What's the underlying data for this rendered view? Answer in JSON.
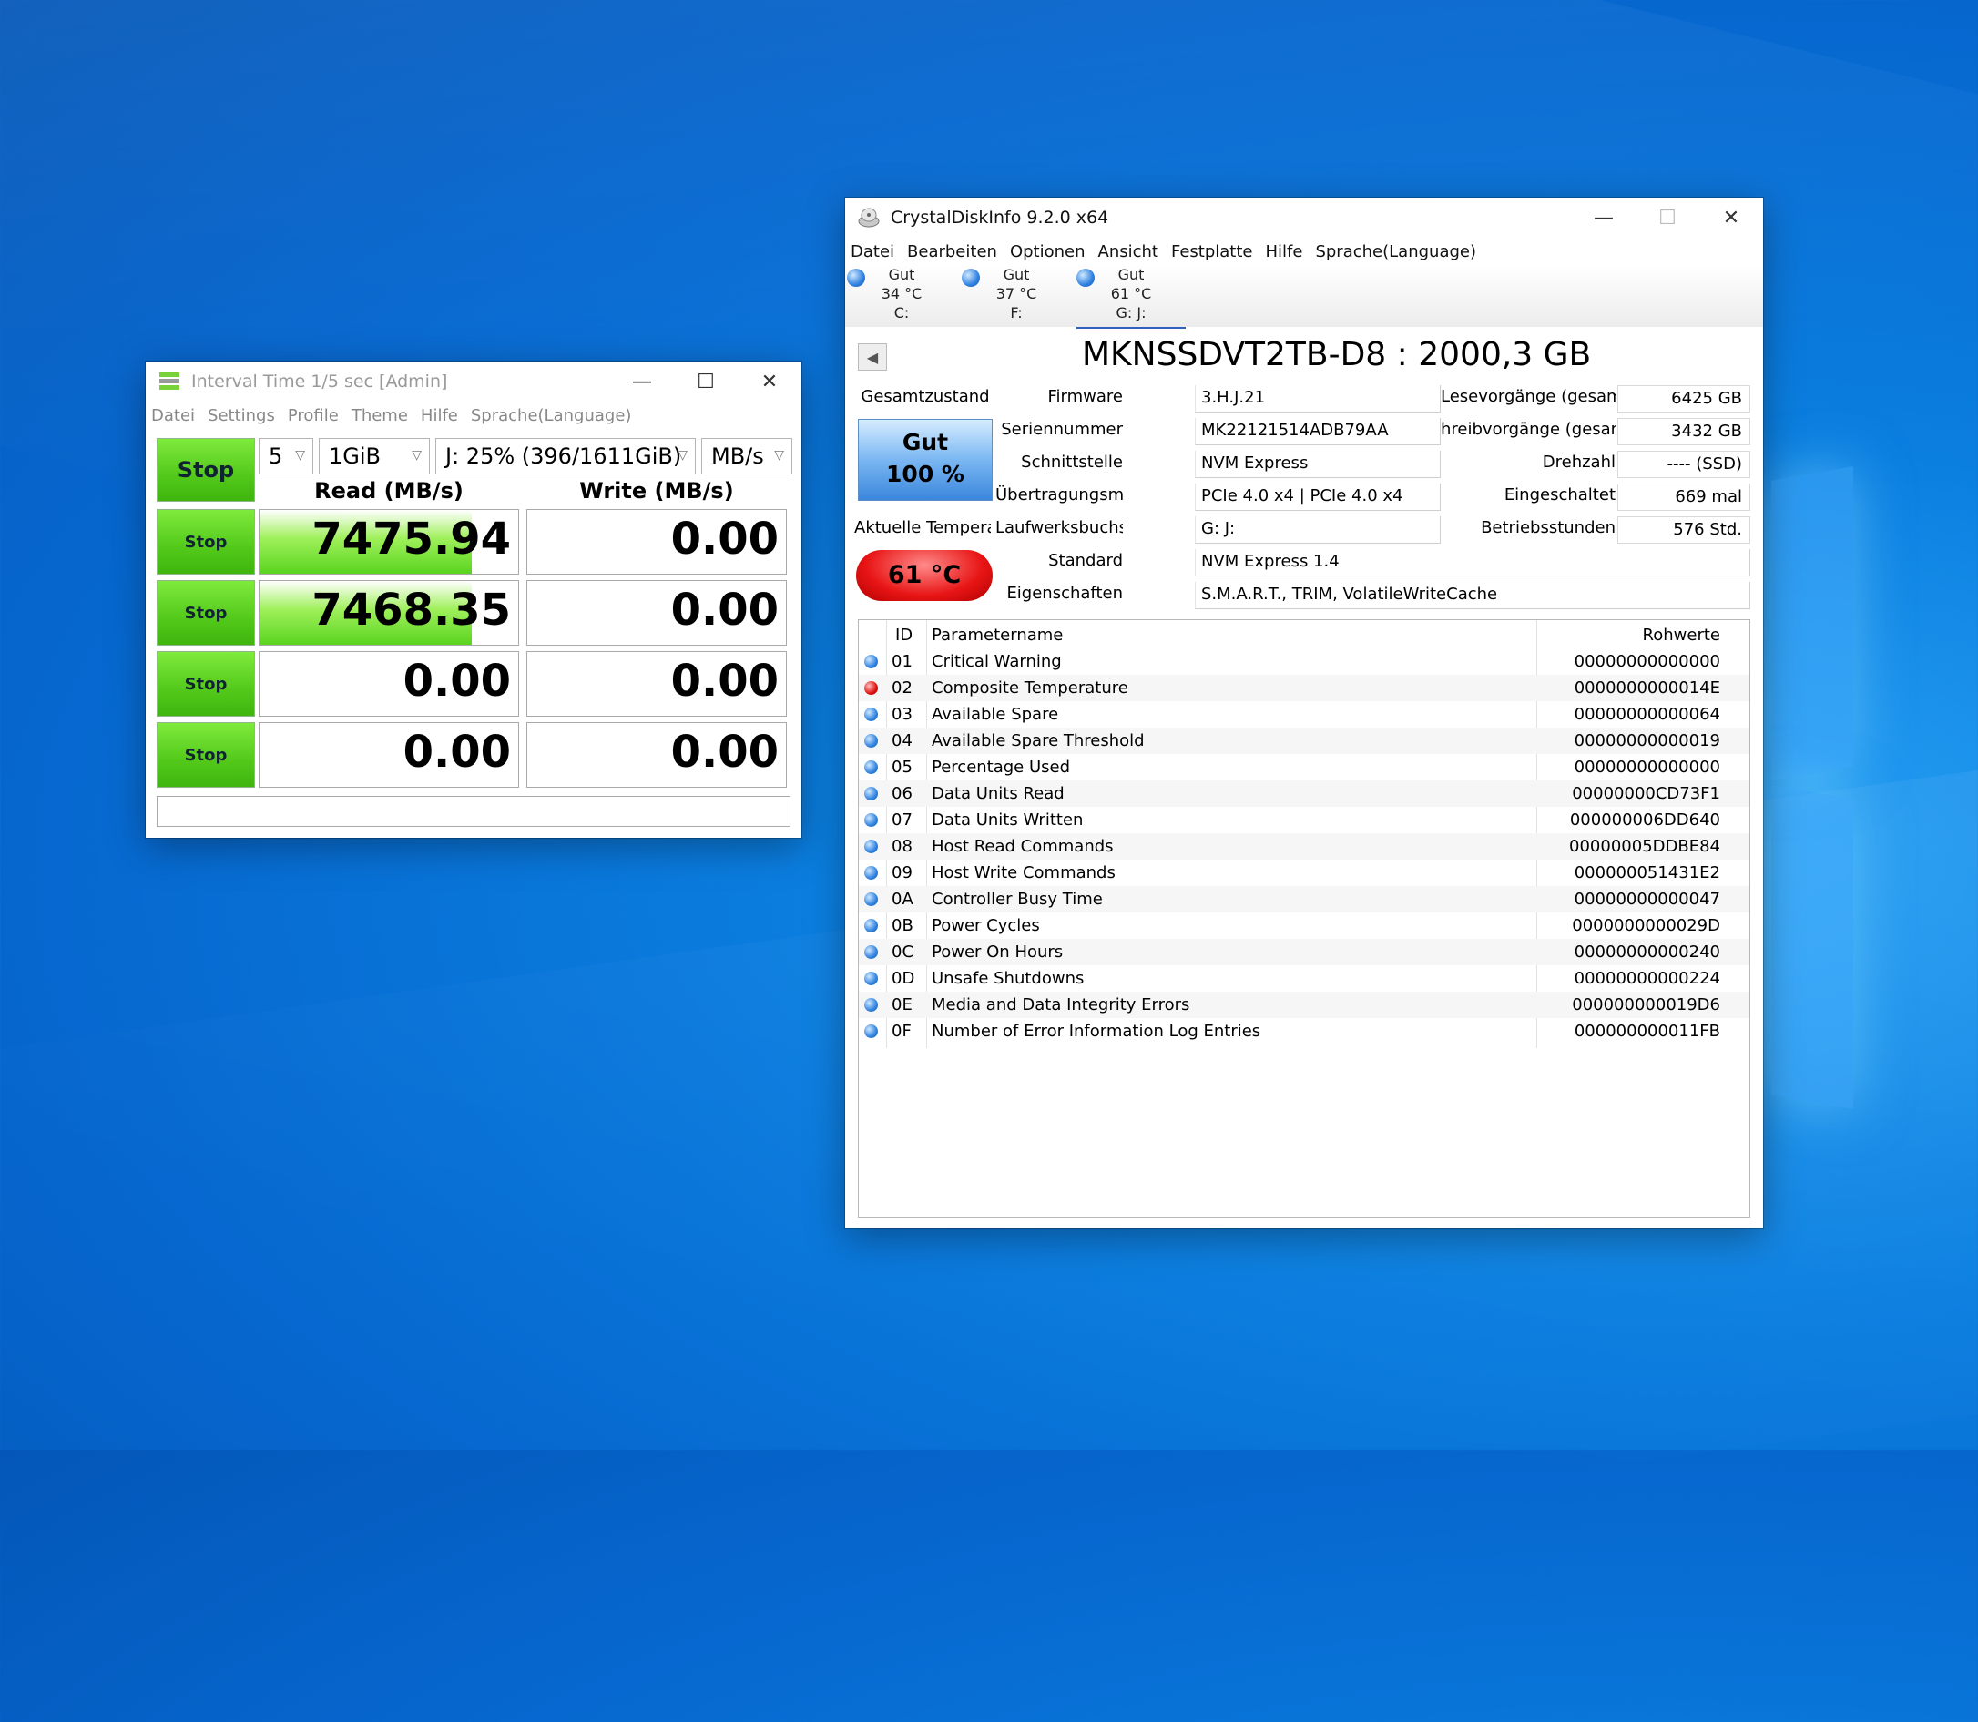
{
  "diskmark": {
    "title": "Interval Time 1/5 sec [Admin]",
    "menu": [
      "Datei",
      "Settings",
      "Profile",
      "Theme",
      "Hilfe",
      "Sprache(Language)"
    ],
    "stop_all_label": "Stop",
    "count": "5",
    "size": "1GiB",
    "drive": "J: 25% (396/1611GiB)",
    "unit": "MB/s",
    "read_header": "Read (MB/s)",
    "write_header": "Write (MB/s)",
    "rows": [
      {
        "stop": "Stop",
        "read": "7475.94",
        "write": "0.00",
        "read_fill": 0.82
      },
      {
        "stop": "Stop",
        "read": "7468.35",
        "write": "0.00",
        "read_fill": 0.82
      },
      {
        "stop": "Stop",
        "read": "0.00",
        "write": "0.00",
        "read_fill": 0
      },
      {
        "stop": "Stop",
        "read": "0.00",
        "write": "0.00",
        "read_fill": 0
      }
    ],
    "status": ""
  },
  "cdi": {
    "title": "CrystalDiskInfo 9.2.0 x64",
    "menu": [
      "Datei",
      "Bearbeiten",
      "Optionen",
      "Ansicht",
      "Festplatte",
      "Hilfe",
      "Sprache(Language)"
    ],
    "drives": [
      {
        "status": "Gut",
        "temp": "34 °C",
        "letter": "C:"
      },
      {
        "status": "Gut",
        "temp": "37 °C",
        "letter": "F:"
      },
      {
        "status": "Gut",
        "temp": "61 °C",
        "letter": "G: J:"
      }
    ],
    "model": "MKNSSDVT2TB-D8 : 2000,3 GB",
    "health_label": "Gesamtzustand",
    "health_status": "Gut",
    "health_percent": "100 %",
    "temp_label": "Aktuelle Temperatu",
    "temp_value": "61 °C",
    "info": {
      "firmware_label": "Firmware",
      "firmware": "3.H.J.21",
      "serial_label": "Seriennummer",
      "serial": "MK22121514ADB79AA",
      "interface_label": "Schnittstelle",
      "interface": "NVM Express",
      "transfer_label": "Übertragungsmodus",
      "transfer": "PCIe 4.0 x4 | PCIe 4.0 x4",
      "letters_label": "Laufwerksbuchstaben",
      "letters": "G: J:",
      "standard_label": "Standard",
      "standard": "NVM Express 1.4",
      "features_label": "Eigenschaften",
      "features": "S.M.A.R.T., TRIM, VolatileWriteCache",
      "reads_label": "Lesevorgänge (gesamt)",
      "reads": "6425 GB",
      "writes_label": "hreibvorgänge (gesamt)",
      "writes": "3432 GB",
      "rpm_label": "Drehzahl",
      "rpm": "---- (SSD)",
      "poweron_label": "Eingeschaltet",
      "poweron": "669 mal",
      "hours_label": "Betriebsstunden",
      "hours": "576 Std."
    },
    "smart_headers": {
      "id": "ID",
      "name": "Parametername",
      "raw": "Rohwerte"
    },
    "smart": [
      {
        "id": "01",
        "name": "Critical Warning",
        "raw": "00000000000000",
        "alert": false
      },
      {
        "id": "02",
        "name": "Composite Temperature",
        "raw": "0000000000014E",
        "alert": true
      },
      {
        "id": "03",
        "name": "Available Spare",
        "raw": "00000000000064",
        "alert": false
      },
      {
        "id": "04",
        "name": "Available Spare Threshold",
        "raw": "00000000000019",
        "alert": false
      },
      {
        "id": "05",
        "name": "Percentage Used",
        "raw": "00000000000000",
        "alert": false
      },
      {
        "id": "06",
        "name": "Data Units Read",
        "raw": "00000000CD73F1",
        "alert": false
      },
      {
        "id": "07",
        "name": "Data Units Written",
        "raw": "000000006DD640",
        "alert": false
      },
      {
        "id": "08",
        "name": "Host Read Commands",
        "raw": "00000005DDBE84",
        "alert": false
      },
      {
        "id": "09",
        "name": "Host Write Commands",
        "raw": "000000051431E2",
        "alert": false
      },
      {
        "id": "0A",
        "name": "Controller Busy Time",
        "raw": "00000000000047",
        "alert": false
      },
      {
        "id": "0B",
        "name": "Power Cycles",
        "raw": "0000000000029D",
        "alert": false
      },
      {
        "id": "0C",
        "name": "Power On Hours",
        "raw": "00000000000240",
        "alert": false
      },
      {
        "id": "0D",
        "name": "Unsafe Shutdowns",
        "raw": "00000000000224",
        "alert": false
      },
      {
        "id": "0E",
        "name": "Media and Data Integrity Errors",
        "raw": "000000000019D6",
        "alert": false
      },
      {
        "id": "0F",
        "name": "Number of Error Information Log Entries",
        "raw": "000000000011FB",
        "alert": false
      }
    ]
  }
}
